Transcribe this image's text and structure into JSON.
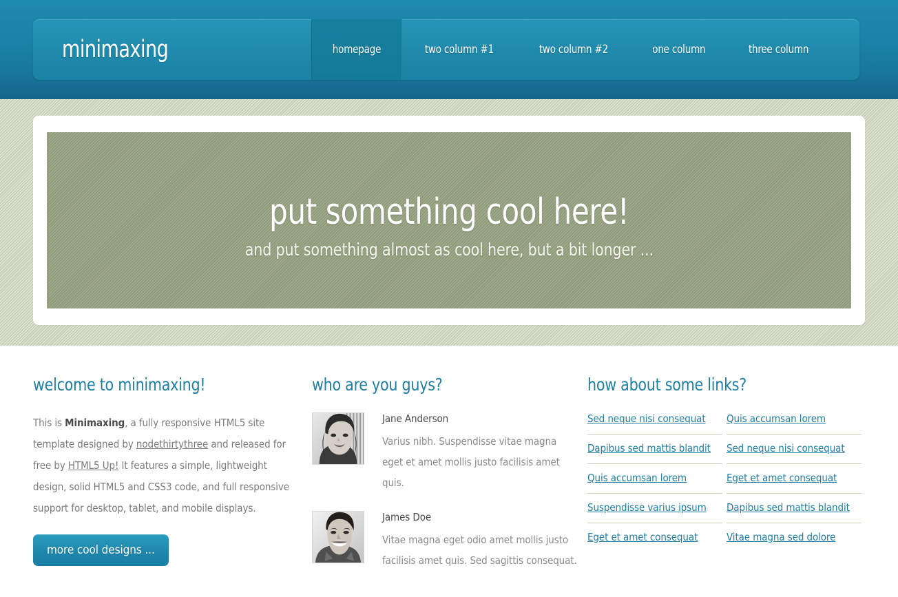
{
  "site": {
    "logo": "minimaxing"
  },
  "nav": {
    "items": [
      {
        "label": "homepage",
        "active": true
      },
      {
        "label": "two column #1",
        "active": false
      },
      {
        "label": "two column #2",
        "active": false
      },
      {
        "label": "one column",
        "active": false
      },
      {
        "label": "three column",
        "active": false
      }
    ]
  },
  "banner": {
    "title": "put something cool here!",
    "subtitle": "and put something almost as cool here, but a bit longer ..."
  },
  "columns": {
    "welcome": {
      "title": "welcome to minimaxing!",
      "text_1": "This is ",
      "bold_1": "Minimaxing",
      "text_2": ", a fully responsive HTML5 site template designed by ",
      "link_1": "nodethirtythree",
      "text_3": " and released for free by ",
      "link_2": "HTML5 Up!",
      "text_4": " It features a simple, lightweight design, solid HTML5 and CSS3 code, and full responsive support for desktop, tablet, and mobile displays.",
      "button_label": "more cool designs ..."
    },
    "people": {
      "title": "who are you guys?",
      "profiles": [
        {
          "name": "Jane Anderson",
          "description": "Varius nibh. Suspendisse vitae magna eget et amet mollis justo facilisis amet quis.",
          "avatar": "avatar-jane-anderson"
        },
        {
          "name": "James Doe",
          "description": "Vitae magna eget odio amet mollis justo facilisis amet quis. Sed sagittis consequat.",
          "avatar": "avatar-james-doe"
        }
      ]
    },
    "links": {
      "title": "how about some links?",
      "left": [
        "Sed neque nisi consequat",
        "Dapibus sed mattis blandit",
        "Quis accumsan lorem",
        "Suspendisse varius ipsum",
        "Eget et amet consequat"
      ],
      "right": [
        "Quis accumsan lorem",
        "Sed neque nisi consequat",
        "Eget et amet consequat",
        "Dapibus sed mattis blandit",
        "Vitae magna sed dolore"
      ]
    }
  },
  "colors": {
    "header_teal": "#1f8aac",
    "accent_link": "#1f7fa4",
    "banner_green": "#9aa585",
    "texture_bg": "#d6dcc6",
    "separator": "#cfd0b8"
  }
}
